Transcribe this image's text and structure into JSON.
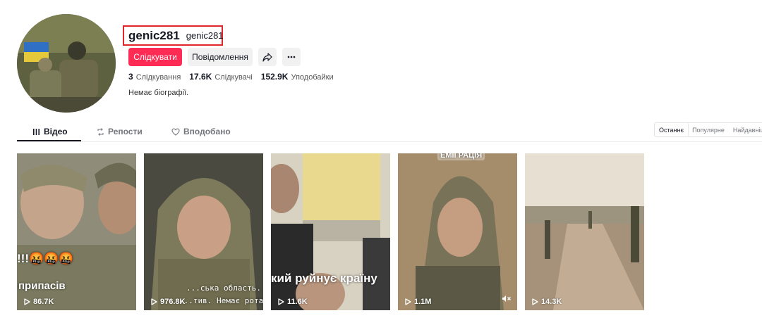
{
  "profile": {
    "username": "genic281",
    "nickname": "genic281",
    "follow_label": "Слідкувати",
    "message_label": "Повідомлення",
    "share_icon": "share-icon",
    "more_icon": "more-icon",
    "bio": "Немає біографії."
  },
  "stats": {
    "following_count": "3",
    "following_label": "Слідкування",
    "followers_count": "17.6K",
    "followers_label": "Слідкувачі",
    "likes_count": "152.9K",
    "likes_label": "Уподобайки"
  },
  "tabs": [
    {
      "label": "Відео",
      "icon": "grid-icon",
      "active": true
    },
    {
      "label": "Репости",
      "icon": "repost-icon",
      "active": false
    },
    {
      "label": "Вподобано",
      "icon": "heart-icon",
      "active": false
    }
  ],
  "sort": [
    "Останнє",
    "Популярне",
    "Найдавніц"
  ],
  "videos": [
    {
      "views": "86.7K",
      "overlay": "припасів",
      "emoji": "!!!🤬🤬🤬"
    },
    {
      "views": "976.8K",
      "overlay_1": "...ська область.",
      "overlay_2": "...тив. Немає ротації"
    },
    {
      "views": "11.6K",
      "overlay": "кий руйнує країну"
    },
    {
      "views": "1.1M",
      "overlay_top": "ЕМІГРАЦІЯ",
      "muted": true
    },
    {
      "views": "14.3K"
    }
  ],
  "colors": {
    "accent": "#fe2c55",
    "highlight_box": "#e0252b"
  }
}
